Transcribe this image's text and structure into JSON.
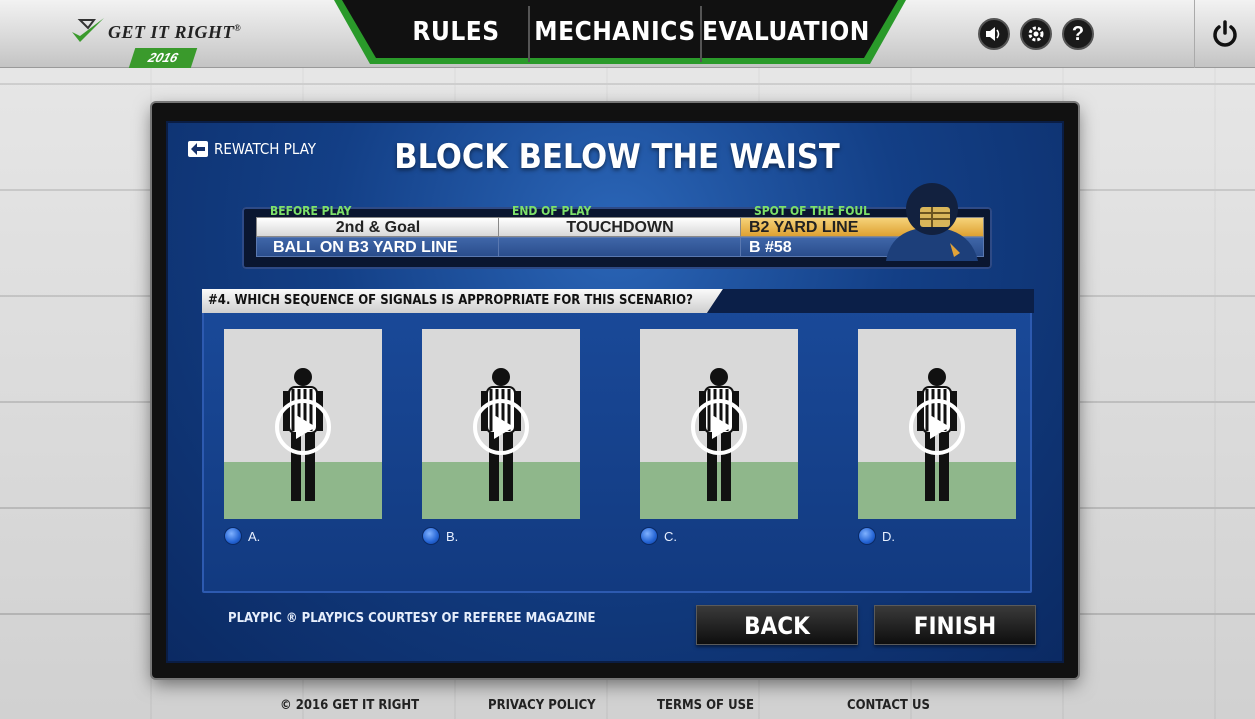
{
  "brand": {
    "name": "GET IT RIGHT",
    "reg": "®",
    "year": "2016"
  },
  "nav": {
    "tabs": [
      "RULES",
      "MECHANICS",
      "EVALUATION"
    ]
  },
  "header_icons": [
    "speaker-icon",
    "gear-icon",
    "help-icon",
    "power-icon"
  ],
  "help_glyph": "?",
  "screen": {
    "rewatch_label": "REWATCH PLAY",
    "title": "BLOCK BELOW THE WAIST"
  },
  "info": {
    "before": {
      "head": "BEFORE PLAY",
      "top": "2nd & Goal",
      "bottom": "BALL ON B3 YARD LINE"
    },
    "end": {
      "head": "END OF PLAY",
      "top": "TOUCHDOWN",
      "bottom": ""
    },
    "spot": {
      "head": "SPOT OF THE FOUL",
      "top": "B2 YARD LINE",
      "bottom": "B #58"
    }
  },
  "question": {
    "label": "#4. WHICH SEQUENCE OF SIGNALS IS APPROPRIATE FOR THIS SCENARIO?",
    "options": [
      {
        "label": "A."
      },
      {
        "label": "B."
      },
      {
        "label": "C."
      },
      {
        "label": "D."
      }
    ]
  },
  "credit": "PLAYPIC ® PLAYPICS COURTESY OF REFEREE MAGAZINE",
  "buttons": {
    "back": "BACK",
    "finish": "FINISH"
  },
  "footer": {
    "copyright": "© 2016 GET IT RIGHT",
    "privacy": "PRIVACY POLICY",
    "terms": "TERMS OF USE",
    "contact": "CONTACT US"
  },
  "colors": {
    "accent_green": "#3a9a2c",
    "screen_blue": "#133f86",
    "highlight_gold": "#dea132"
  }
}
